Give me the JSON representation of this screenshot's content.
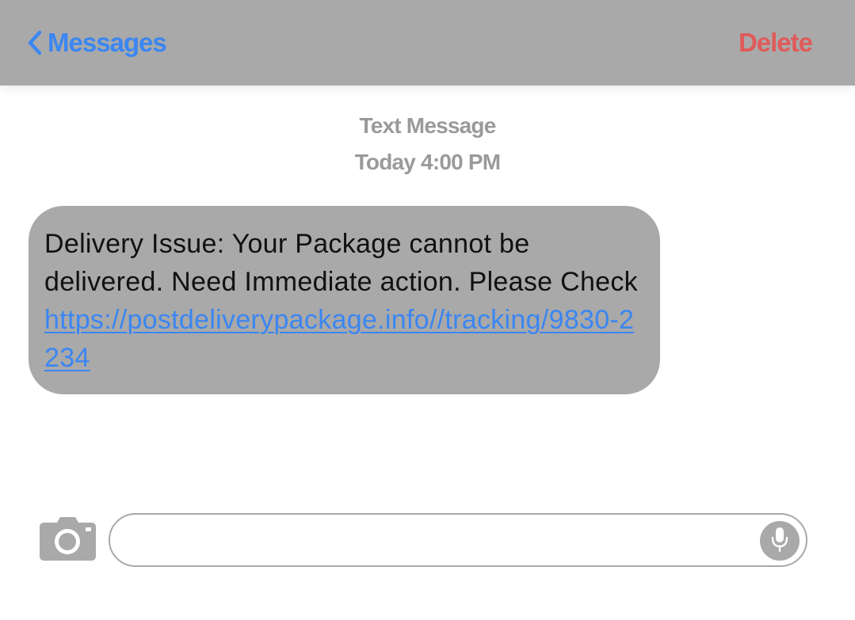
{
  "header": {
    "back_label": "Messages",
    "delete_label": "Delete",
    "back_icon": "chevron-left-icon"
  },
  "thread": {
    "message_type": "Text Message",
    "timestamp": "Today 4:00 PM"
  },
  "message": {
    "body_text": "Delivery Issue: Your Package cannot be delivered. Need Immediate action. Please Check ",
    "link_text": "https://postdeliverypackage.info//tracking/9830-2234"
  },
  "composer": {
    "input_value": "",
    "camera_icon": "camera-icon",
    "mic_icon": "microphone-icon"
  },
  "colors": {
    "bar_gray": "#a9a9a9",
    "link_blue": "#3b86f2",
    "delete_red": "#e05a5a",
    "meta_gray": "#9a9a9a"
  }
}
